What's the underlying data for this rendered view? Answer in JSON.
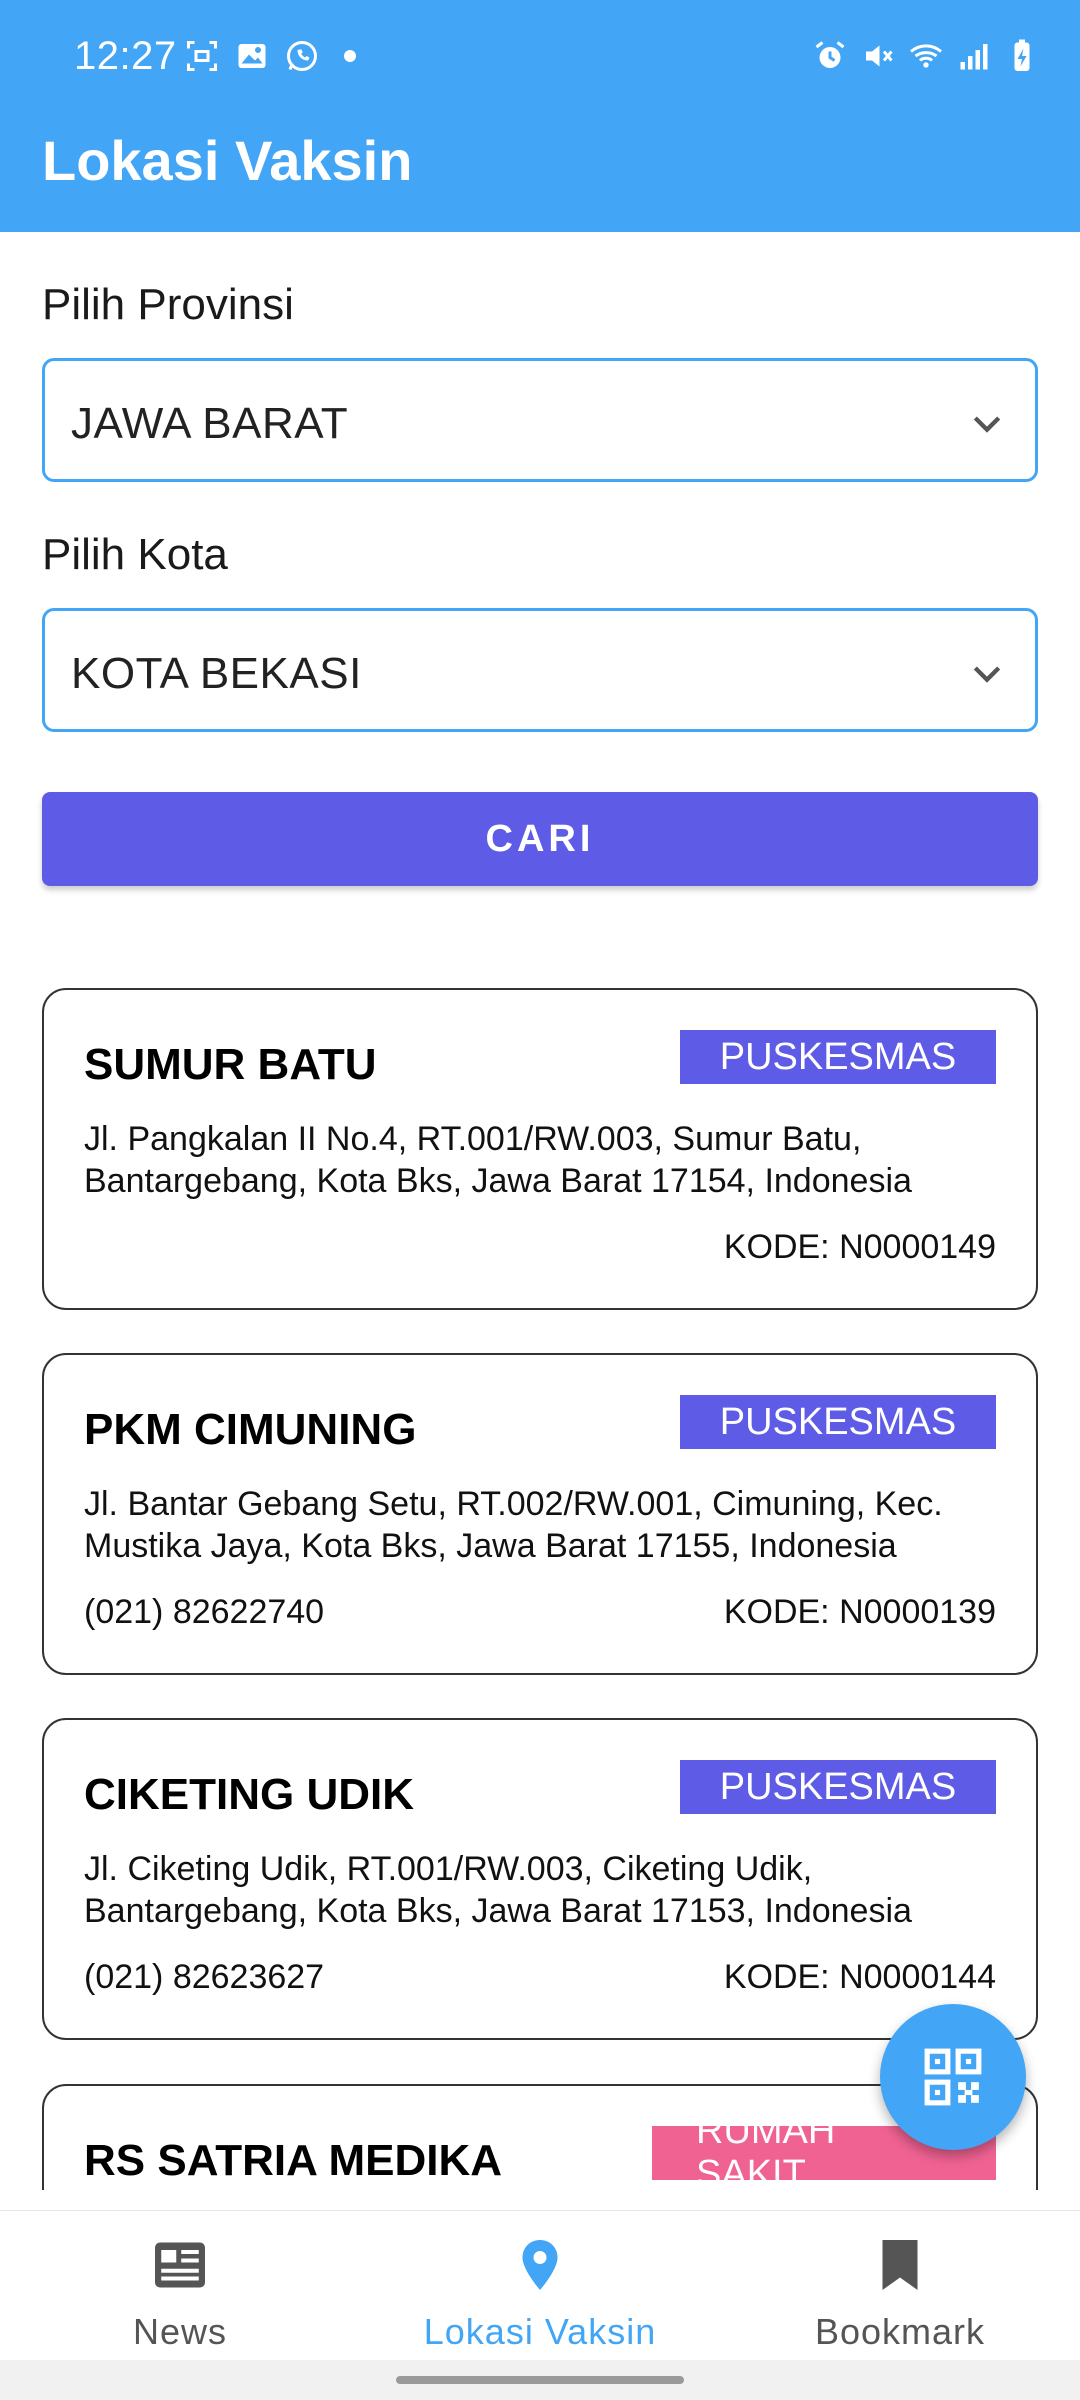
{
  "status_bar": {
    "time": "12:27"
  },
  "app_bar": {
    "title": "Lokasi Vaksin"
  },
  "form": {
    "province_label": "Pilih Provinsi",
    "province_value": "JAWA BARAT",
    "city_label": "Pilih Kota",
    "city_value": "KOTA BEKASI",
    "search_button": "CARI"
  },
  "results": [
    {
      "name": "SUMUR BATU",
      "type": "PUSKESMAS",
      "address": "Jl. Pangkalan II No.4, RT.001/RW.003, Sumur Batu, Bantargebang, Kota Bks, Jawa Barat 17154, Indonesia",
      "phone": "",
      "kode": "KODE: N0000149"
    },
    {
      "name": "PKM CIMUNING",
      "type": "PUSKESMAS",
      "address": "Jl. Bantar Gebang Setu, RT.002/RW.001, Cimuning, Kec. Mustika Jaya, Kota Bks, Jawa Barat 17155, Indonesia",
      "phone": "(021) 82622740",
      "kode": "KODE: N0000139"
    },
    {
      "name": "CIKETING UDIK",
      "type": "PUSKESMAS",
      "address": "Jl. Ciketing Udik, RT.001/RW.003, Ciketing Udik, Bantargebang, Kota Bks, Jawa Barat 17153, Indonesia",
      "phone": "(021) 82623627",
      "kode": "KODE: N0000144"
    },
    {
      "name": "RS SATRIA MEDIKA",
      "type": "RUMAH SAKIT",
      "address": "",
      "phone": "",
      "kode": ""
    }
  ],
  "bottom_nav": {
    "items": [
      {
        "label": "News",
        "icon": "newspaper-icon",
        "active": false
      },
      {
        "label": "Lokasi Vaksin",
        "icon": "location-pin-icon",
        "active": true
      },
      {
        "label": "Bookmark",
        "icon": "bookmark-icon",
        "active": false
      }
    ]
  },
  "colors": {
    "primary": "#42A5F5",
    "button": "#5E5CE6",
    "badge_puskesmas": "#5E5CE6",
    "badge_rumah_sakit": "#F06292"
  }
}
